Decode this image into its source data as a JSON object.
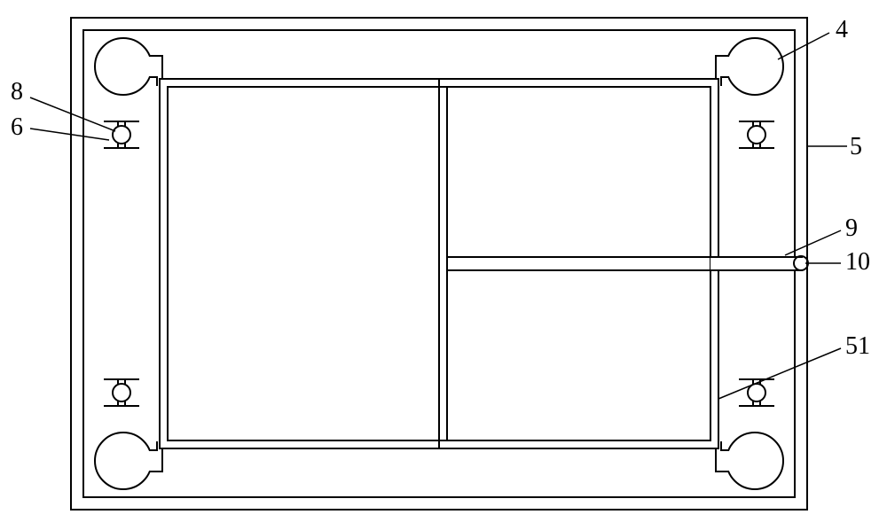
{
  "labels": {
    "l4": "4",
    "l5": "5",
    "l6": "6",
    "l8": "8",
    "l9": "9",
    "l10": "10",
    "l51": "51"
  }
}
